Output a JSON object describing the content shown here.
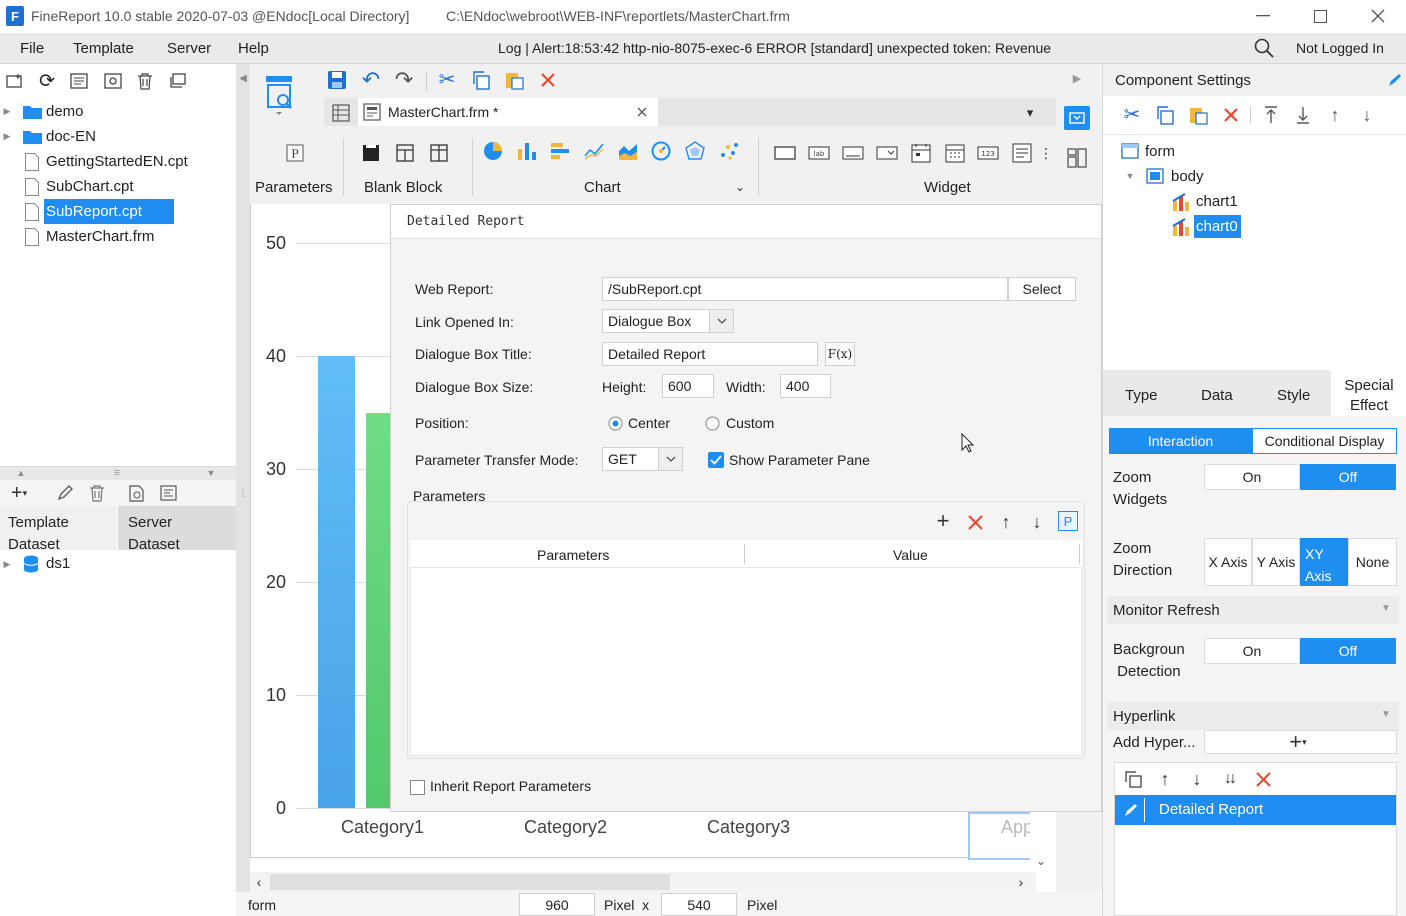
{
  "window": {
    "title": "FineReport 10.0 stable 2020-07-03 @ENdoc[Local Directory]",
    "path": "C:\\ENdoc\\webroot\\WEB-INF\\reportlets/MasterChart.frm"
  },
  "menu": {
    "items": [
      "File",
      "Template",
      "Server",
      "Help"
    ],
    "log": "Log | Alert:18:53:42 http-nio-8075-exec-6 ERROR [standard] unexpected token: Revenue",
    "login": "Not Logged In"
  },
  "filetree": {
    "items": [
      "demo",
      "doc-EN",
      "GettingStartedEN.cpt",
      "SubChart.cpt",
      "SubReport.cpt",
      "MasterChart.frm"
    ],
    "selected": "SubReport.cpt"
  },
  "dataset": {
    "tab_template": "Template\nDataset",
    "tab_server": "Server\nDataset",
    "items": [
      "ds1"
    ]
  },
  "editor": {
    "tab": "MasterChart.frm *",
    "groups": [
      "Parameters",
      "Blank Block",
      "Chart",
      "Widget"
    ],
    "status_mode": "form",
    "width": "960",
    "pixel_x": "Pixel  x",
    "height": "540",
    "pixel": "Pixel"
  },
  "chart": {
    "yticks": [
      "50",
      "40",
      "30",
      "20",
      "10",
      "0"
    ],
    "categories": [
      "Category1",
      "Category2",
      "Category3"
    ],
    "partial_label": "App"
  },
  "chart_data": {
    "type": "bar",
    "categories": [
      "Category1",
      "Category2",
      "Category3"
    ],
    "series": [
      {
        "values": [
          40,
          null,
          null
        ],
        "color": "#5cb6f5"
      },
      {
        "values": [
          35,
          null,
          null
        ],
        "color": "#5fd37a"
      }
    ],
    "ylim": [
      0,
      50
    ],
    "yticks": [
      0,
      10,
      20,
      30,
      40,
      50
    ],
    "grid": true
  },
  "dialog": {
    "title": "Detailed Report",
    "web_report_label": "Web Report:",
    "web_report_value": "/SubReport.cpt",
    "select_label": "Select",
    "link_label": "Link Opened In:",
    "link_value": "Dialogue Box",
    "box_title_label": "Dialogue Box Title:",
    "box_title_value": "Detailed Report",
    "fx_label": "F(x)",
    "size_label": "Dialogue Box Size:",
    "height_label": "Height:",
    "height_value": "600",
    "width_label": "Width:",
    "width_value": "400",
    "position_label": "Position:",
    "center_label": "Center",
    "custom_label": "Custom",
    "mode_label": "Parameter Transfer Mode:",
    "mode_value": "GET",
    "show_pane_label": "Show Parameter Pane",
    "params_label": "Parameters",
    "col_params": "Parameters",
    "col_value": "Value",
    "inherit_label": "Inherit Report Parameters",
    "p_label": "P"
  },
  "component": {
    "title": "Component Settings",
    "tree": [
      "form",
      "body",
      "chart1",
      "chart0"
    ],
    "selected": "chart0",
    "tabs": [
      "Type",
      "Data",
      "Style",
      "Special\nEffect"
    ],
    "subtabs": [
      "Interaction",
      "Conditional Display"
    ],
    "zoom_widgets": "Zoom\nWidgets",
    "on": "On",
    "off": "Off",
    "zoom_direction": "Zoom\nDirection",
    "directions": [
      "X Axis",
      "Y Axis",
      "XY\nAxis",
      "None"
    ],
    "monitor_refresh": "Monitor Refresh",
    "background_detection": "Backgroun\n Detection",
    "hyperlink": "Hyperlink",
    "add_hyper": "Add Hyper...",
    "link_item": "Detailed Report"
  },
  "colors": {
    "accent": "#1f8ef1",
    "selected": "#1e8cf0",
    "delete": "#e34a2f",
    "bar_blue": "#5cb6f5",
    "bar_green": "#5fd37a"
  }
}
